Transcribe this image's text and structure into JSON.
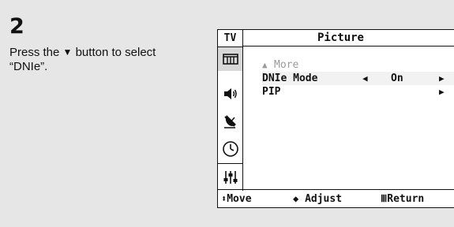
{
  "step": {
    "number": "2",
    "text_before": "Press the ",
    "button_glyph": "▼",
    "text_after": " button to select “DNIe”."
  },
  "osd": {
    "tv_label": "TV",
    "title": "Picture",
    "icons": [
      "picture-icon",
      "sound-icon",
      "channel-icon",
      "setup-icon",
      "input-icon"
    ],
    "menu": [
      {
        "arrow": "▲",
        "label": "More"
      },
      {
        "label": "DNIe Mode",
        "left_arrow": "◀",
        "value": "On",
        "right_arrow": "▶"
      },
      {
        "label": "PIP",
        "right_arrow": "▶"
      }
    ],
    "footer": [
      {
        "glyph": "⬍",
        "label": "Move"
      },
      {
        "glyph": "◆",
        "label": "Adjust"
      },
      {
        "glyph": "Ⅲ",
        "label": "Return"
      }
    ]
  }
}
